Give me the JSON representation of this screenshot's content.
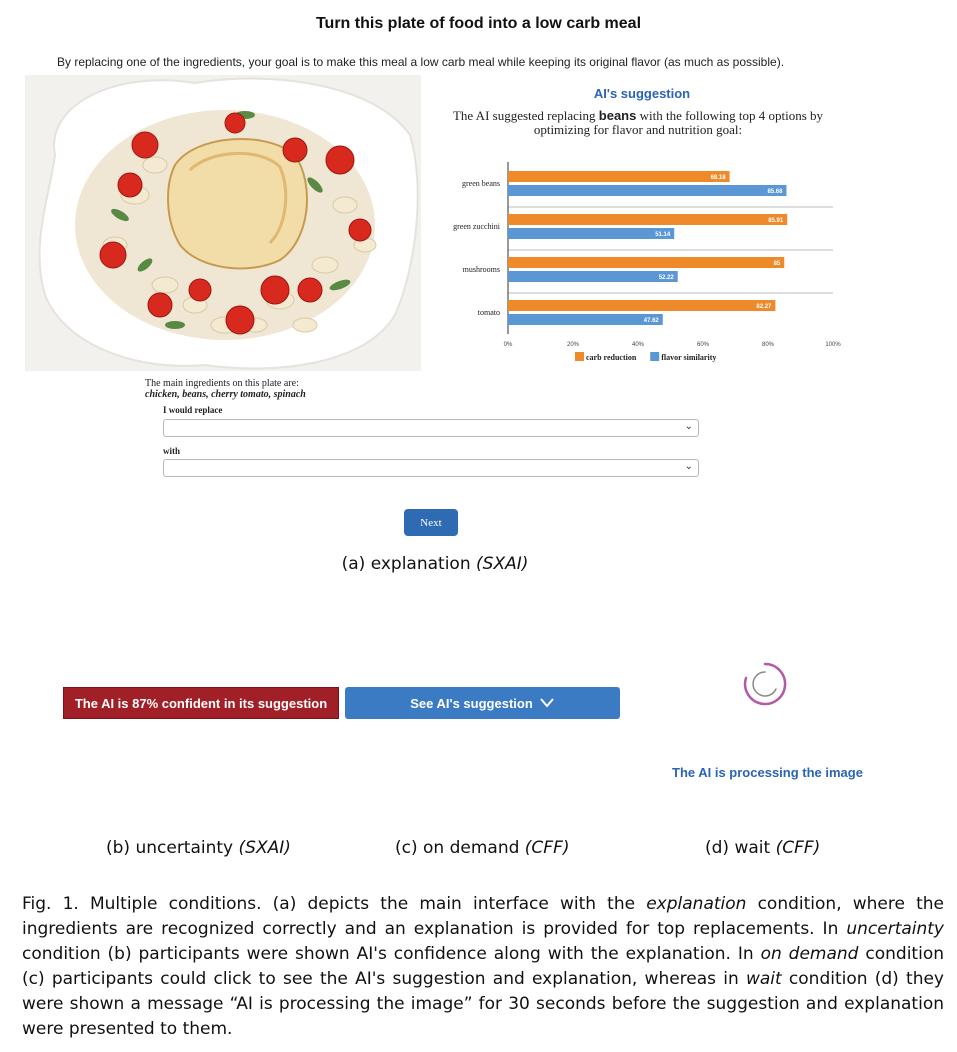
{
  "task": {
    "title": "Turn this plate of food into a low carb meal",
    "intro": "By replacing one of the ingredients, your goal is to make this meal a low carb meal while keeping its original flavor (as much as possible)."
  },
  "ai_panel": {
    "heading": "AI's suggestion",
    "desc_prefix": "The AI suggested replacing ",
    "desc_ingredient": "beans",
    "desc_suffix": " with the following top 4 options by optimizing for flavor and nutrition goal:"
  },
  "chart_data": {
    "type": "bar",
    "orientation": "horizontal",
    "categories": [
      "green beans",
      "green zucchini",
      "mushrooms",
      "tomato"
    ],
    "series": [
      {
        "name": "carb reduction",
        "values": [
          68.18,
          85.91,
          85,
          82.27
        ],
        "color": "#ee8a2a"
      },
      {
        "name": "flavor similarity",
        "values": [
          85.68,
          51.14,
          52.22,
          47.62
        ],
        "color": "#5b97d5"
      }
    ],
    "value_labels": [
      [
        "68.18",
        "85.68"
      ],
      [
        "85.91",
        "51.14"
      ],
      [
        "85",
        "52.22"
      ],
      [
        "82.27",
        "47.62"
      ]
    ],
    "xticks": [
      "0%",
      "20%",
      "40%",
      "60%",
      "80%",
      "100%"
    ],
    "xlim": [
      0,
      100
    ],
    "grid": true,
    "legend_position": "bottom"
  },
  "form": {
    "ingredients_label": "The main ingredients on this plate are:",
    "ingredients": "chicken, beans, cherry tomato, spinach",
    "replace_label": "I would replace",
    "with_label": "with",
    "replace_value": "",
    "with_value": "",
    "next_label": "Next"
  },
  "conditions": {
    "a_caption": "(a) explanation",
    "a_tag": "(SXAI)",
    "confidence_text": "The AI is 87% confident in its suggestion",
    "see_suggestion_label": "See AI's suggestion",
    "processing_text": "The AI is processing the image",
    "b_caption": "(b) uncertainty",
    "b_tag": "(SXAI)",
    "c_caption": "(c) on demand",
    "c_tag": "(CFF)",
    "d_caption": "(d) wait",
    "d_tag": "(CFF)"
  },
  "figure_caption": {
    "p1": "Fig. 1.  Multiple conditions. (a) depicts the main interface with the ",
    "i1": "explanation",
    "p2": " condition, where the ingredients are recognized correctly and an explanation is provided for top replacements. In ",
    "i2": "uncertainty",
    "p3": " condition (b) participants were shown AI's confidence along with the explanation. In ",
    "i3": "on demand",
    "p4": " condition (c) participants could click to see the AI's suggestion and explanation, whereas in ",
    "i4": "wait",
    "p5": " condition (d) they were shown a message “AI is processing the image” for 30 seconds before the suggestion and explanation were presented to them."
  },
  "colors": {
    "accent_blue": "#2b63b5",
    "button_blue": "#3b7bc3",
    "confidence_red": "#a11f26"
  }
}
